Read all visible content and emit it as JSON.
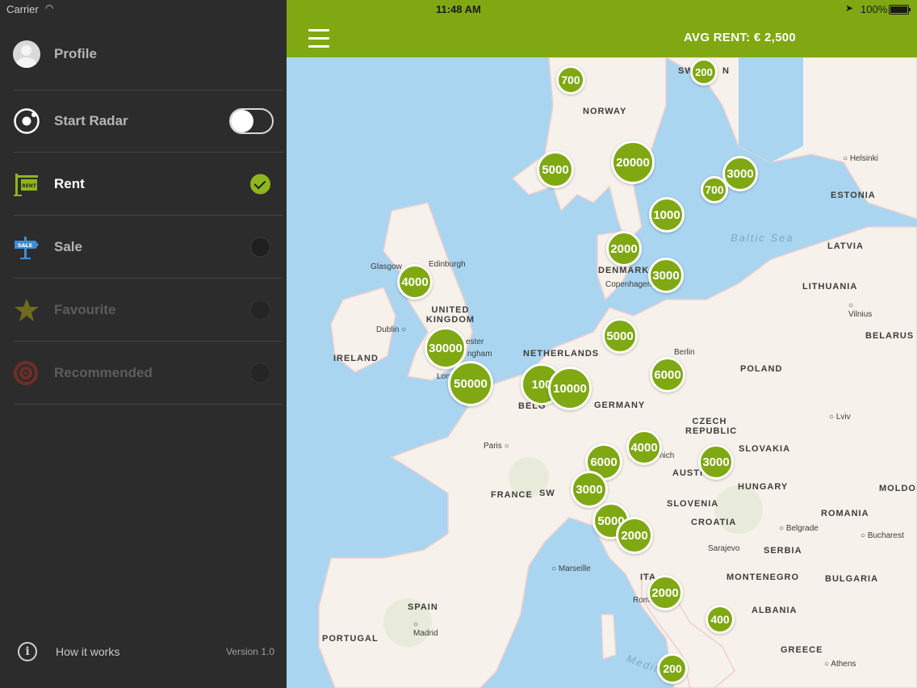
{
  "status_bar": {
    "carrier": "Carrier",
    "time": "11:48 AM",
    "battery": "100%"
  },
  "sidebar": {
    "profile_label": "Profile",
    "items": [
      {
        "label": "Start Radar",
        "control": "toggle",
        "state": "off"
      },
      {
        "label": "Rent",
        "control": "radio",
        "state": "checked"
      },
      {
        "label": "Sale",
        "control": "radio",
        "state": "unchecked"
      },
      {
        "label": "Favourite",
        "control": "radio",
        "state": "disabled"
      },
      {
        "label": "Recommended",
        "control": "radio",
        "state": "disabled"
      }
    ],
    "footer": {
      "how_it_works": "How it works",
      "version": "Version 1.0"
    }
  },
  "header": {
    "avg_rent": "AVG RENT: € 2,500"
  },
  "map": {
    "countries": [
      "NORWAY",
      "ESTONIA",
      "LATVIA",
      "LITHUANIA",
      "BELARUS",
      "DENMARK",
      "UNITED KINGDOM",
      "IRELAND",
      "NETHERLANDS",
      "POLAND",
      "GERMANY",
      "CZECH REPUBLIC",
      "SLOVAKIA",
      "FRANCE",
      "HUNGARY",
      "SLOVENIA",
      "CROATIA",
      "ROMANIA",
      "MOLDO",
      "SERBIA",
      "MONTENEGRO",
      "BULGARIA",
      "SPAIN",
      "PORTUGAL",
      "ALBANIA",
      "GREECE",
      "ITA",
      "AUSTR",
      "SW",
      "N",
      "SW",
      "BELG"
    ],
    "cities": [
      "Helsinki",
      "Glasgow",
      "Edinburgh",
      "Copenhagen",
      "Vilnius",
      "Dublin",
      "Berlin",
      "Lviv",
      "Paris",
      "Belgrade",
      "Bucharest",
      "Sarajevo",
      "Marseille",
      "Madrid",
      "Athens",
      "Rom",
      "Lon",
      "nich",
      "nchester",
      "ngham"
    ],
    "seas": [
      "Baltic Sea",
      "Mediter"
    ],
    "clusters": [
      "700",
      "200",
      "5000",
      "20000",
      "3000",
      "700",
      "1000",
      "2000",
      "4000",
      "3000",
      "30000",
      "5000",
      "50000",
      "100",
      "10000",
      "6000",
      "4000",
      "6000",
      "3000",
      "3000",
      "5000",
      "2000",
      "2000",
      "400",
      "200"
    ]
  }
}
